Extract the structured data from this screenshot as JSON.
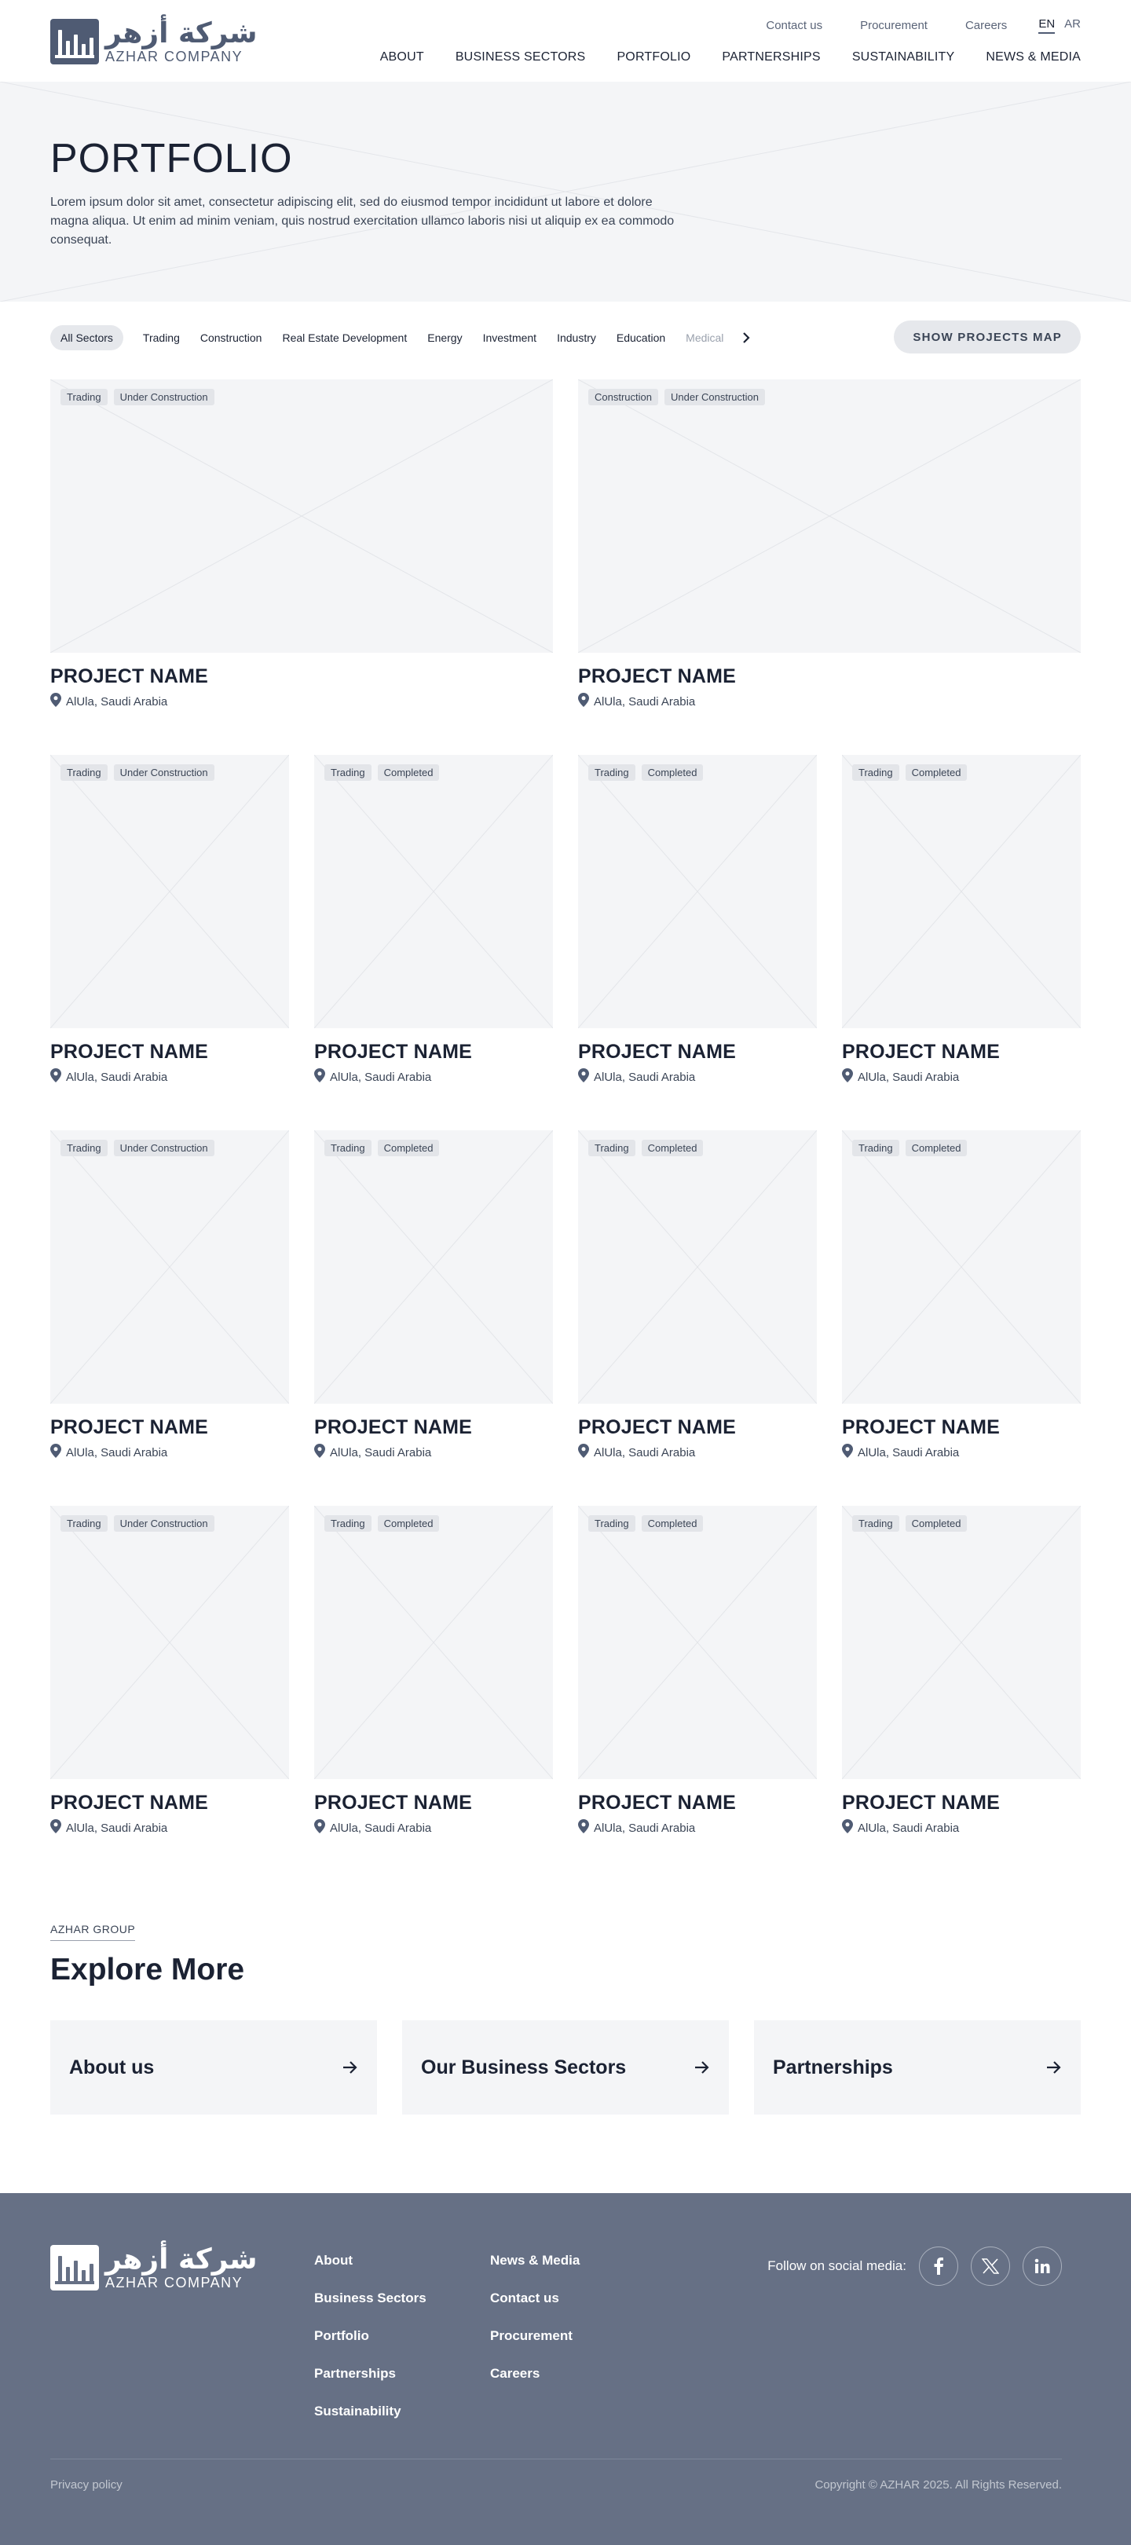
{
  "header": {
    "logo_ar": "شركة أزهر",
    "logo_en": "AZHAR COMPANY",
    "utility_links": [
      "Contact us",
      "Procurement",
      "Careers"
    ],
    "languages": [
      "EN",
      "AR"
    ],
    "active_language": "EN",
    "nav": [
      "ABOUT",
      "BUSINESS SECTORS",
      "PORTFOLIO",
      "PARTNERSHIPS",
      "SUSTAINABILITY",
      "NEWS & MEDIA"
    ]
  },
  "hero": {
    "title": "PORTFOLIO",
    "description": "Lorem ipsum dolor sit amet, consectetur adipiscing elit, sed do eiusmod tempor incididunt ut labore et dolore magna aliqua. Ut enim ad minim veniam, quis nostrud exercitation ullamco laboris nisi ut aliquip ex ea commodo consequat."
  },
  "filters": {
    "chips": [
      "All Sectors",
      "Trading",
      "Construction",
      "Real Estate Development",
      "Energy",
      "Investment",
      "Industry",
      "Education",
      "Medical"
    ],
    "active": "All Sectors",
    "map_button": "SHOW PROJECTS MAP"
  },
  "projects": [
    {
      "tags": [
        "Trading",
        "Under Construction"
      ],
      "name": "PROJECT NAME",
      "location": "AlUla, Saudi Arabia"
    },
    {
      "tags": [
        "Construction",
        "Under Construction"
      ],
      "name": "PROJECT NAME",
      "location": "AlUla, Saudi Arabia"
    },
    {
      "tags": [
        "Trading",
        "Under Construction"
      ],
      "name": "PROJECT NAME",
      "location": "AlUla, Saudi Arabia"
    },
    {
      "tags": [
        "Trading",
        "Completed"
      ],
      "name": "PROJECT NAME",
      "location": "AlUla, Saudi Arabia"
    },
    {
      "tags": [
        "Trading",
        "Completed"
      ],
      "name": "PROJECT NAME",
      "location": "AlUla, Saudi Arabia"
    },
    {
      "tags": [
        "Trading",
        "Completed"
      ],
      "name": "PROJECT NAME",
      "location": "AlUla, Saudi Arabia"
    },
    {
      "tags": [
        "Trading",
        "Under Construction"
      ],
      "name": "PROJECT NAME",
      "location": "AlUla, Saudi Arabia"
    },
    {
      "tags": [
        "Trading",
        "Completed"
      ],
      "name": "PROJECT NAME",
      "location": "AlUla, Saudi Arabia"
    },
    {
      "tags": [
        "Trading",
        "Completed"
      ],
      "name": "PROJECT NAME",
      "location": "AlUla, Saudi Arabia"
    },
    {
      "tags": [
        "Trading",
        "Completed"
      ],
      "name": "PROJECT NAME",
      "location": "AlUla, Saudi Arabia"
    },
    {
      "tags": [
        "Trading",
        "Under Construction"
      ],
      "name": "PROJECT NAME",
      "location": "AlUla, Saudi Arabia"
    },
    {
      "tags": [
        "Trading",
        "Completed"
      ],
      "name": "PROJECT NAME",
      "location": "AlUla, Saudi Arabia"
    },
    {
      "tags": [
        "Trading",
        "Completed"
      ],
      "name": "PROJECT NAME",
      "location": "AlUla, Saudi Arabia"
    },
    {
      "tags": [
        "Trading",
        "Completed"
      ],
      "name": "PROJECT NAME",
      "location": "AlUla, Saudi Arabia"
    }
  ],
  "explore": {
    "eyebrow": "AZHAR GROUP",
    "title": "Explore More",
    "cards": [
      "About us",
      "Our Business Sectors",
      "Partnerships"
    ]
  },
  "footer": {
    "logo_ar": "شركة أزهر",
    "logo_en": "AZHAR COMPANY",
    "col1": [
      "About",
      "Business Sectors",
      "Portfolio",
      "Partnerships",
      "Sustainability"
    ],
    "col2": [
      "News & Media",
      "Contact us",
      "Procurement",
      "Careers"
    ],
    "social_label": "Follow on social media:",
    "social_icons": [
      "facebook-icon",
      "x-icon",
      "linkedin-icon"
    ],
    "privacy": "Privacy policy",
    "copyright": "Copyright © AZHAR 2025. All Rights Reserved."
  },
  "colors": {
    "primary": "#4f5b73",
    "text": "#1b2233",
    "placeholder_bg": "#f4f5f7",
    "footer_bg": "#667085"
  }
}
